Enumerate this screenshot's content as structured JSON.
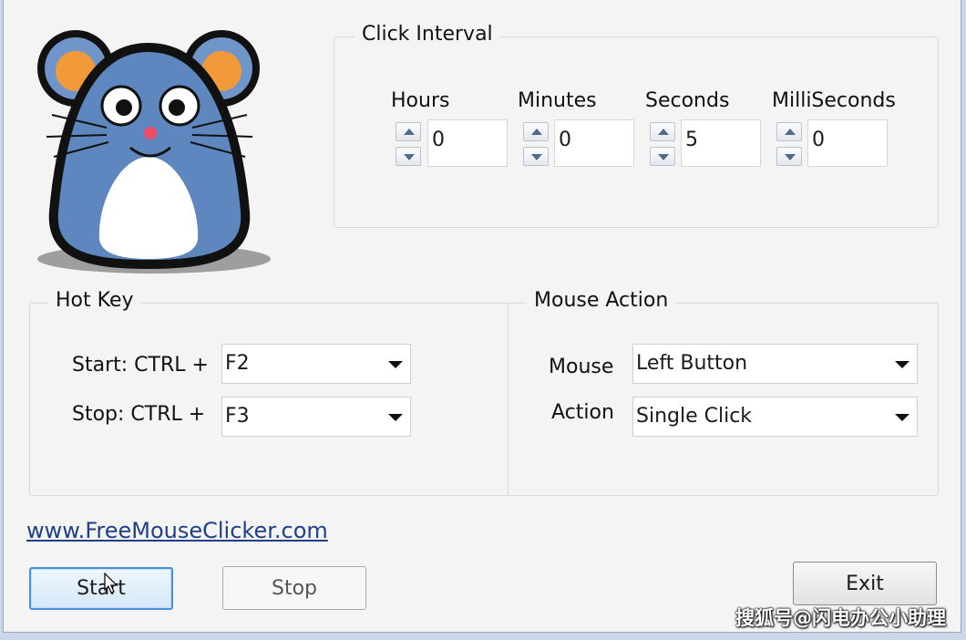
{
  "click_interval": {
    "title": "Click Interval",
    "fields": [
      {
        "label": "Hours",
        "value": "0"
      },
      {
        "label": "Minutes",
        "value": "0"
      },
      {
        "label": "Seconds",
        "value": "5"
      },
      {
        "label": "MilliSeconds",
        "value": "0"
      }
    ]
  },
  "hot_key": {
    "title": "Hot Key",
    "start_label": "Start: CTRL +",
    "start_value": "F2",
    "stop_label": "Stop: CTRL +",
    "stop_value": "F3"
  },
  "mouse_action": {
    "title": "Mouse Action",
    "mouse_label": "Mouse",
    "mouse_value": "Left Button",
    "action_label": "Action",
    "action_value": "Single Click"
  },
  "website_link": "www.FreeMouseClicker.com",
  "buttons": {
    "start": "Start",
    "stop": "Stop",
    "exit": "Exit"
  },
  "watermark": "搜狐号@闪电办公小助理",
  "icons": {
    "logo": "mouse-mascot-icon",
    "spin_up": "arrow-up-icon",
    "spin_down": "arrow-down-icon",
    "dropdown": "chevron-down-icon",
    "pointer": "mouse-cursor-icon"
  },
  "colors": {
    "mascot_body": "#6f95c9",
    "mascot_ears": "#f29a3a",
    "accent": "#4a90d9",
    "link": "#1f3f86"
  }
}
